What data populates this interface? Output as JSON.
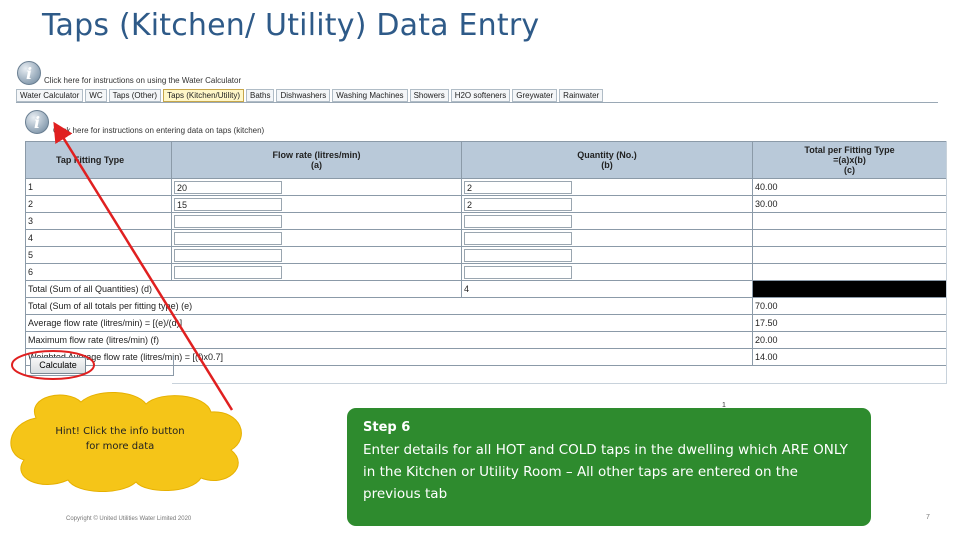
{
  "slide": {
    "title": "Taps (Kitchen/ Utility) Data Entry",
    "copyright": "Copyright © United Utilities Water Limited 2020",
    "page_number": "7",
    "tick_mark": "1"
  },
  "info": {
    "top_icon": "info-icon",
    "top_text": "Click here for instructions on using the Water Calculator",
    "section_text": "Click here for instructions on entering data on taps (kitchen)"
  },
  "tabs": [
    {
      "label": "Water Calculator",
      "active": false
    },
    {
      "label": "WC",
      "active": false
    },
    {
      "label": "Taps (Other)",
      "active": false
    },
    {
      "label": "Taps (Kitchen/Utility)",
      "active": true
    },
    {
      "label": "Baths",
      "active": false
    },
    {
      "label": "Dishwashers",
      "active": false
    },
    {
      "label": "Washing Machines",
      "active": false
    },
    {
      "label": "Showers",
      "active": false
    },
    {
      "label": "H2O softeners",
      "active": false
    },
    {
      "label": "Greywater",
      "active": false
    },
    {
      "label": "Rainwater",
      "active": false
    }
  ],
  "table": {
    "headers": {
      "type": "Tap Fitting Type",
      "flow_line1": "Flow rate (litres/min)",
      "flow_line2": "(a)",
      "qty_line1": "Quantity (No.)",
      "qty_line2": "(b)",
      "total_line1": "Total per Fitting Type",
      "total_line2": "=(a)x(b)",
      "total_line3": "(c)"
    },
    "rows": [
      {
        "id": "1",
        "flow": "20",
        "qty": "2",
        "total": "40.00"
      },
      {
        "id": "2",
        "flow": "15",
        "qty": "2",
        "total": "30.00"
      },
      {
        "id": "3",
        "flow": "",
        "qty": "",
        "total": ""
      },
      {
        "id": "4",
        "flow": "",
        "qty": "",
        "total": ""
      },
      {
        "id": "5",
        "flow": "",
        "qty": "",
        "total": ""
      },
      {
        "id": "6",
        "flow": "",
        "qty": "",
        "total": ""
      }
    ],
    "summary": {
      "total_qty_label": "Total (Sum of all Quantities) (d)",
      "total_qty_value": "4",
      "total_sum_label": "Total (Sum of all totals per fitting type) (e)",
      "total_sum_value": "70.00",
      "avg_label": "Average flow rate (litres/min) = [(e)/(d)]",
      "avg_value": "17.50",
      "max_label": "Maximum flow rate (litres/min) (f)",
      "max_value": "20.00",
      "weighted_label": "Weighted Average flow rate (litres/min) = [(f)x0.7]",
      "weighted_value": "14.00"
    }
  },
  "calculate_button": "Calculate",
  "hint": {
    "line1": "Hint!  Click the info button",
    "line2": "for more data"
  },
  "step": {
    "title": "Step 6",
    "body": "Enter details for all HOT and COLD taps in the dwelling which ARE ONLY in the Kitchen or Utility Room – All other taps are entered on the previous tab"
  },
  "colors": {
    "title": "#2e5a88",
    "step_box": "#2e8b2e",
    "cloud": "#f5c518",
    "arrow": "#e02020",
    "header_bg": "#b9c9d9",
    "active_tab": "#fff7c8"
  }
}
